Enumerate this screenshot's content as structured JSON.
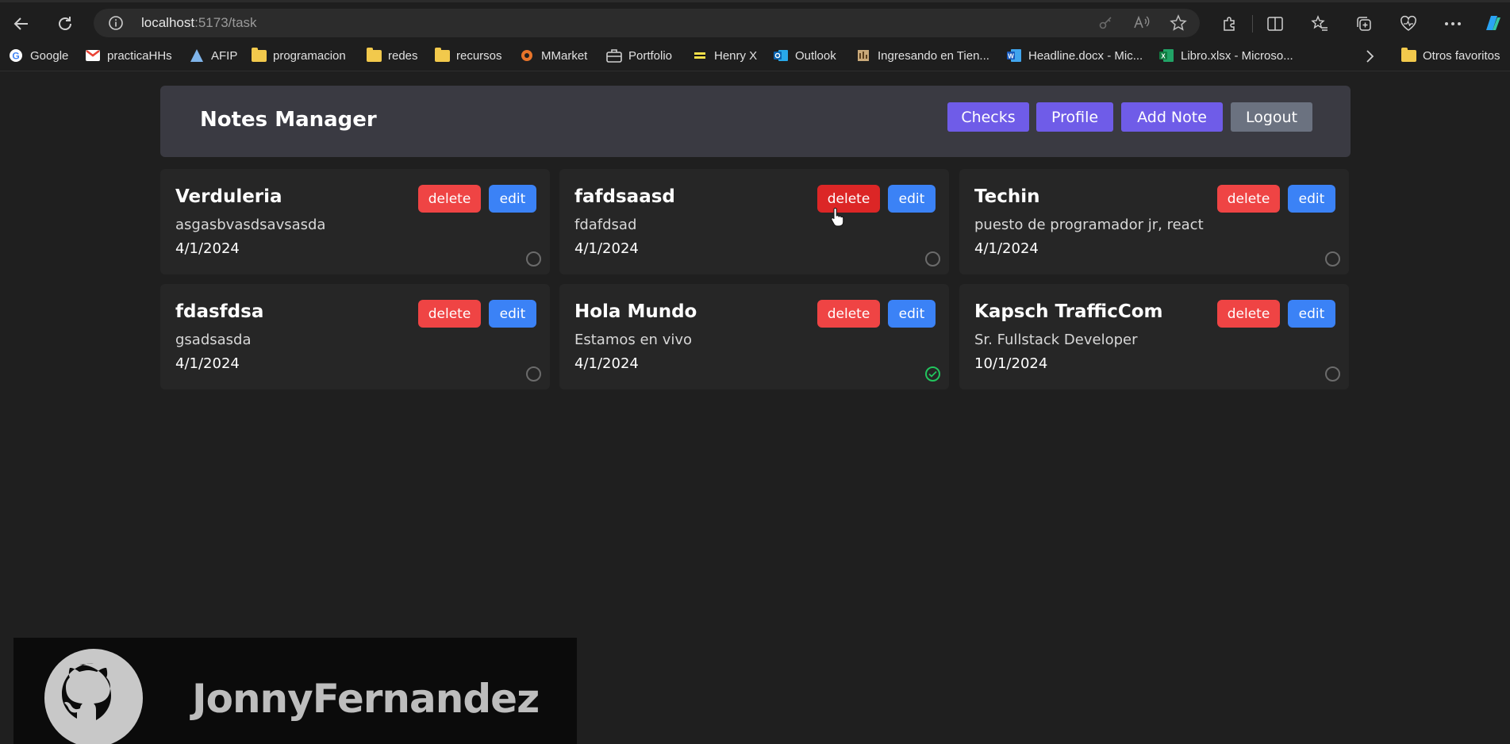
{
  "browser": {
    "url_host": "localhost",
    "url_path": ":5173/task",
    "bookmarks": [
      {
        "label": "Google",
        "icon": "google-icon"
      },
      {
        "label": "practicaHHs",
        "icon": "gmail-icon"
      },
      {
        "label": "AFIP",
        "icon": "afip-icon"
      },
      {
        "label": "programacion",
        "icon": "folder-icon"
      },
      {
        "label": "redes",
        "icon": "folder-icon"
      },
      {
        "label": "recursos",
        "icon": "folder-icon"
      },
      {
        "label": "MMarket",
        "icon": "mmarket-icon"
      },
      {
        "label": "Portfolio",
        "icon": "briefcase-icon"
      },
      {
        "label": "Henry X",
        "icon": "henry-icon"
      },
      {
        "label": "Outlook",
        "icon": "outlook-icon"
      },
      {
        "label": "Ingresando en Tien...",
        "icon": "site-icon"
      },
      {
        "label": "Headline.docx - Mic...",
        "icon": "word-icon"
      },
      {
        "label": "Libro.xlsx - Microso...",
        "icon": "excel-icon"
      }
    ],
    "other_favorites": "Otros favoritos"
  },
  "app": {
    "title": "Notes Manager",
    "buttons": {
      "checks": "Checks",
      "profile": "Profile",
      "add_note": "Add Note",
      "logout": "Logout"
    },
    "notes": [
      {
        "title": "Verduleria",
        "description": "asgasbvasdsavsasda",
        "date": "4/1/2024",
        "done": false
      },
      {
        "title": "fafdsaasd",
        "description": "fdafdsad",
        "date": "4/1/2024",
        "done": false
      },
      {
        "title": "Techin",
        "description": "puesto de programador jr, react",
        "date": "4/1/2024",
        "done": false
      },
      {
        "title": "fdasfdsa",
        "description": "gsadsasda",
        "date": "4/1/2024",
        "done": false
      },
      {
        "title": "Hola Mundo",
        "description": "Estamos en vivo",
        "date": "4/1/2024",
        "done": true
      },
      {
        "title": "Kapsch TrafficCom",
        "description": "Sr. Fullstack Developer",
        "date": "10/1/2024",
        "done": false
      }
    ],
    "delete_label": "delete",
    "edit_label": "edit"
  },
  "overlay": {
    "github_user": "JonnyFernandez"
  },
  "colors": {
    "primary_button": "#6f5ce8",
    "logout_button": "#6b7280",
    "delete_button": "#ef4444",
    "edit_button": "#3b82f6",
    "done_check": "#22c55e"
  }
}
